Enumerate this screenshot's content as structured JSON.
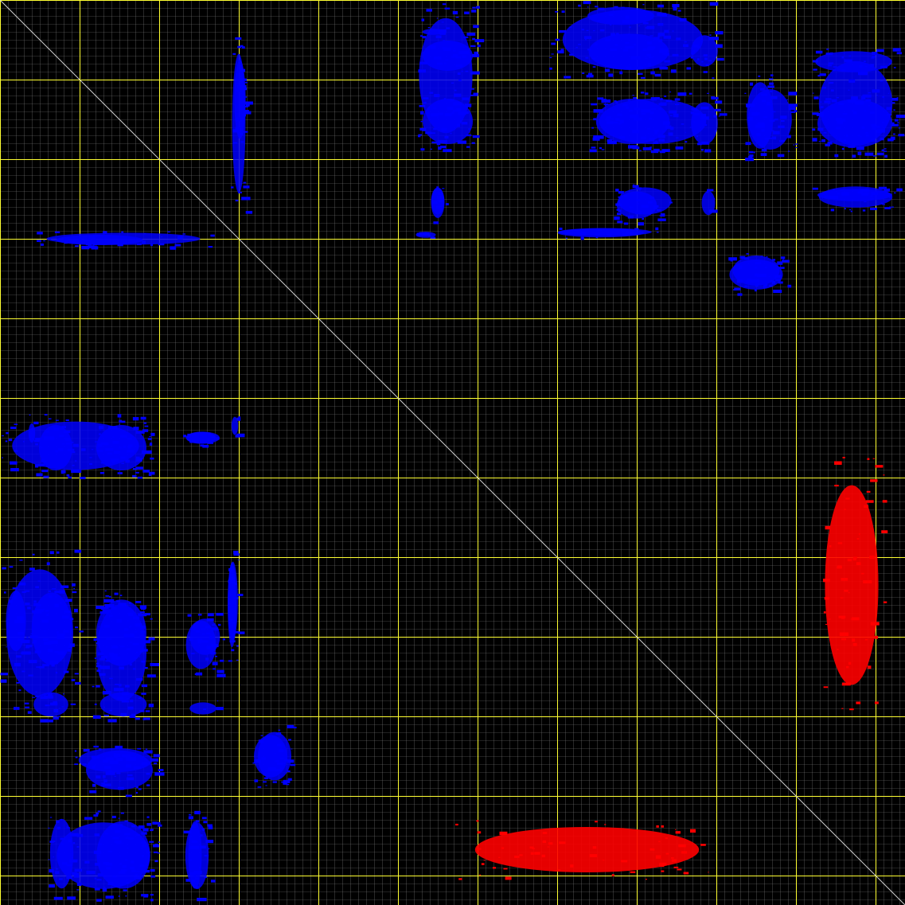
{
  "colors": {
    "background": "#000000",
    "minor_grid": "#7a7a7a",
    "major_grid": "#ffff33",
    "diagonal": "#cfcfcf",
    "symmetric": "#0000ff",
    "asymmetric": "#ff0000"
  },
  "matrix": {
    "n": 1137,
    "minor_step": 10,
    "major_step": 100,
    "blocks": [
      {
        "group": "symmetric",
        "r": [
          35,
          45
        ],
        "c": [
          528,
          560
        ]
      },
      {
        "group": "symmetric",
        "r": [
          45,
          95
        ],
        "c": [
          525,
          600
        ]
      },
      {
        "group": "symmetric",
        "r": [
          5,
          35
        ],
        "c": [
          730,
          830
        ]
      },
      {
        "group": "symmetric",
        "r": [
          35,
          95
        ],
        "c": [
          730,
          850
        ]
      },
      {
        "group": "symmetric",
        "r": [
          38,
          90
        ],
        "c": [
          865,
          905
        ]
      },
      {
        "group": "symmetric",
        "r": [
          60,
          95
        ],
        "c": [
          1015,
          1130
        ]
      },
      {
        "group": "symmetric",
        "r": [
          115,
          190
        ],
        "c": [
          525,
          600
        ]
      },
      {
        "group": "symmetric",
        "r": [
          115,
          190
        ],
        "c": [
          740,
          850
        ]
      },
      {
        "group": "symmetric",
        "r": [
          120,
          190
        ],
        "c": [
          865,
          905
        ]
      },
      {
        "group": "symmetric",
        "r": [
          100,
          200
        ],
        "c": [
          935,
          1000
        ]
      },
      {
        "group": "symmetric",
        "r": [
          115,
          195
        ],
        "c": [
          1018,
          1130
        ]
      },
      {
        "group": "symmetric",
        "r": [
          60,
          190
        ],
        "c": [
          293,
          310
        ]
      },
      {
        "group": "symmetric",
        "r": [
          230,
          275
        ],
        "c": [
          540,
          560
        ]
      },
      {
        "group": "symmetric",
        "r": [
          230,
          275
        ],
        "c": [
          770,
          850
        ]
      },
      {
        "group": "symmetric",
        "r": [
          235,
          255
        ],
        "c": [
          1018,
          1130
        ]
      },
      {
        "group": "symmetric",
        "r": [
          285,
          298
        ],
        "c": [
          690,
          830
        ]
      },
      {
        "group": "symmetric",
        "r": [
          290,
          310
        ],
        "c": [
          40,
          270
        ]
      },
      {
        "group": "symmetric",
        "r": [
          320,
          370
        ],
        "c": [
          910,
          990
        ]
      },
      {
        "group": "symmetric",
        "r": [
          520,
          600
        ],
        "c": [
          0,
          190
        ]
      },
      {
        "group": "symmetric",
        "r": [
          540,
          560
        ],
        "c": [
          230,
          280
        ]
      },
      {
        "group": "symmetric",
        "r": [
          520,
          550
        ],
        "c": [
          290,
          300
        ]
      },
      {
        "group": "symmetric",
        "r": [
          690,
          900
        ],
        "c": [
          0,
          100
        ]
      },
      {
        "group": "symmetric",
        "r": [
          740,
          900
        ],
        "c": [
          115,
          190
        ]
      },
      {
        "group": "symmetric",
        "r": [
          690,
          820
        ],
        "c": [
          285,
          300
        ]
      },
      {
        "group": "symmetric",
        "r": [
          770,
          830
        ],
        "c": [
          235,
          280
        ]
      },
      {
        "group": "symmetric",
        "r": [
          880,
          900
        ],
        "c": [
          235,
          275
        ]
      },
      {
        "group": "symmetric",
        "r": [
          935,
          975
        ],
        "c": [
          90,
          200
        ]
      },
      {
        "group": "symmetric",
        "r": [
          915,
          985
        ],
        "c": [
          315,
          365
        ]
      },
      {
        "group": "symmetric",
        "r": [
          1020,
          1130
        ],
        "c": [
          60,
          200
        ]
      },
      {
        "group": "symmetric",
        "r": [
          1020,
          1130
        ],
        "c": [
          230,
          265
        ]
      },
      {
        "group": "asymmetric",
        "r": [
          570,
          900
        ],
        "c": [
          1030,
          1110
        ]
      },
      {
        "group": "asymmetric",
        "r": [
          1030,
          1105
        ],
        "c": [
          570,
          905
        ]
      }
    ]
  }
}
